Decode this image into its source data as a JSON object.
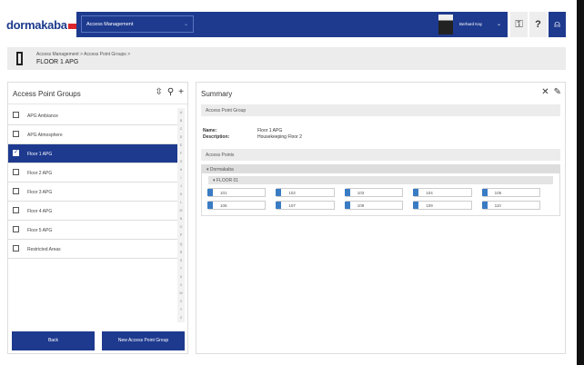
{
  "header": {
    "logo": "dormakaba",
    "app_select": "Access Management",
    "user_name": "Berhard Kay",
    "icons": [
      "key-icon",
      "help-icon",
      "notification-icon"
    ],
    "help": "?"
  },
  "breadcrumb": {
    "path": "Access Management > Access Point Groups >",
    "title": "FLOOR 1 APG"
  },
  "left": {
    "title": "Access Point Groups",
    "items": [
      {
        "label": "APG Ambiance",
        "checked": false
      },
      {
        "label": "APG Atmosphere",
        "checked": false
      },
      {
        "label": "Floor 1 APG",
        "checked": true
      },
      {
        "label": "Floor 2 APG",
        "checked": false
      },
      {
        "label": "Floor 3 APG",
        "checked": false
      },
      {
        "label": "Floor 4 APG",
        "checked": false
      },
      {
        "label": "Floor 5 APG",
        "checked": false
      },
      {
        "label": "Restricted Areas",
        "checked": false
      }
    ],
    "alphabet": [
      "A",
      "B",
      "C",
      "D",
      "E",
      "F",
      "G",
      "H",
      "I",
      "J",
      "K",
      "L",
      "M",
      "N",
      "O",
      "P",
      "Q",
      "R",
      "S",
      "T",
      "U",
      "V",
      "W",
      "X",
      "Y",
      "Z"
    ],
    "back": "Back",
    "new": "New Access Point Group"
  },
  "summary": {
    "title": "Summary",
    "group_section": "Access Point Group",
    "name_label": "Name:",
    "name": "Floor 1 APG",
    "desc_label": "Description:",
    "desc": "Housekeeping Floor 2",
    "points_section": "Access Points",
    "site": "Dormakaba",
    "floor": "FLOOR 01",
    "points": [
      "101",
      "102",
      "103",
      "104",
      "105",
      "106",
      "107",
      "108",
      "109",
      "110"
    ]
  },
  "colors": {
    "primary": "#1e3a8f",
    "point": "#3a7cc4"
  }
}
